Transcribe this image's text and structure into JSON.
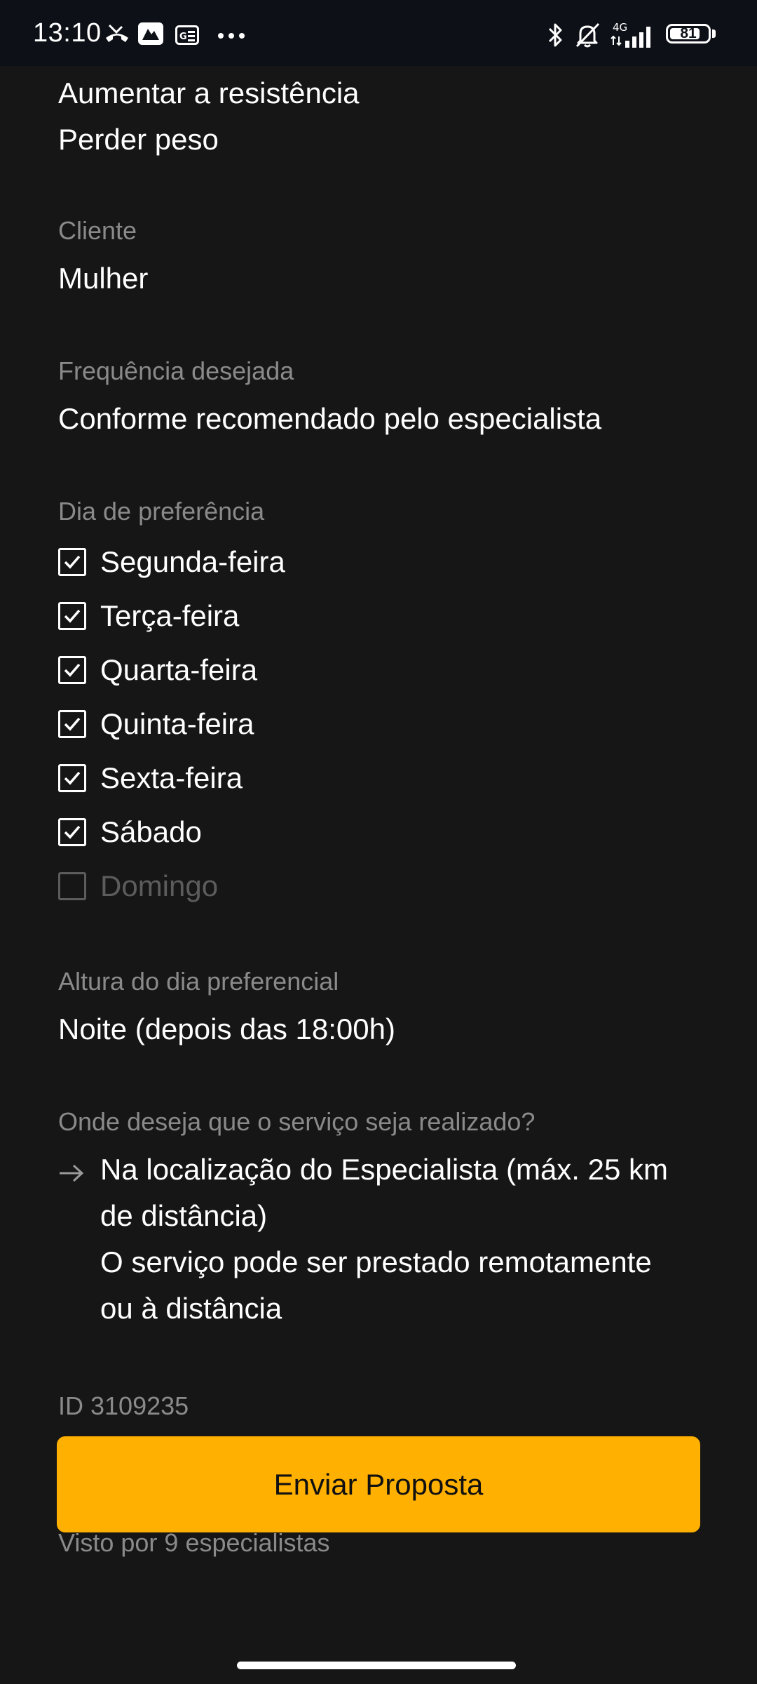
{
  "status_bar": {
    "time": "13:10",
    "battery": "81",
    "battery_level": 0.81,
    "network": "4G",
    "icons": [
      "missed-call-icon",
      "app-notification-icon",
      "gallery-icon",
      "more-notifications-icon",
      "bluetooth-icon",
      "silent-bell-icon",
      "signal-icon",
      "battery-icon"
    ]
  },
  "goals": [
    "Aumentar a resistência",
    "Perder peso"
  ],
  "client": {
    "label": "Cliente",
    "value": "Mulher"
  },
  "frequency": {
    "label": "Frequência desejada",
    "value": "Conforme recomendado pelo especialista"
  },
  "preferred_days": {
    "label": "Dia de preferência",
    "days": [
      {
        "label": "Segunda-feira",
        "checked": true
      },
      {
        "label": "Terça-feira",
        "checked": true
      },
      {
        "label": "Quarta-feira",
        "checked": true
      },
      {
        "label": "Quinta-feira",
        "checked": true
      },
      {
        "label": "Sexta-feira",
        "checked": true
      },
      {
        "label": "Sábado",
        "checked": true
      },
      {
        "label": "Domingo",
        "checked": false
      }
    ]
  },
  "time_of_day": {
    "label": "Altura do dia preferencial",
    "value": "Noite (depois das 18:00h)"
  },
  "location": {
    "label": "Onde deseja que o serviço seja realizado?",
    "lines": [
      "Na localização do Especialista (máx. 25 km",
      "de distância)",
      "O serviço pode ser prestado remotamente",
      "ou à distância"
    ]
  },
  "request_id": "ID 3109235",
  "send_button_label": "Enviar Proposta",
  "views_text": "Visto por 9 especialistas",
  "colors": {
    "background": "#161616",
    "status_bar": "#0d1117",
    "accent": "#ffb000",
    "label": "#8a8a8a",
    "disabled": "#5c5c5c"
  }
}
